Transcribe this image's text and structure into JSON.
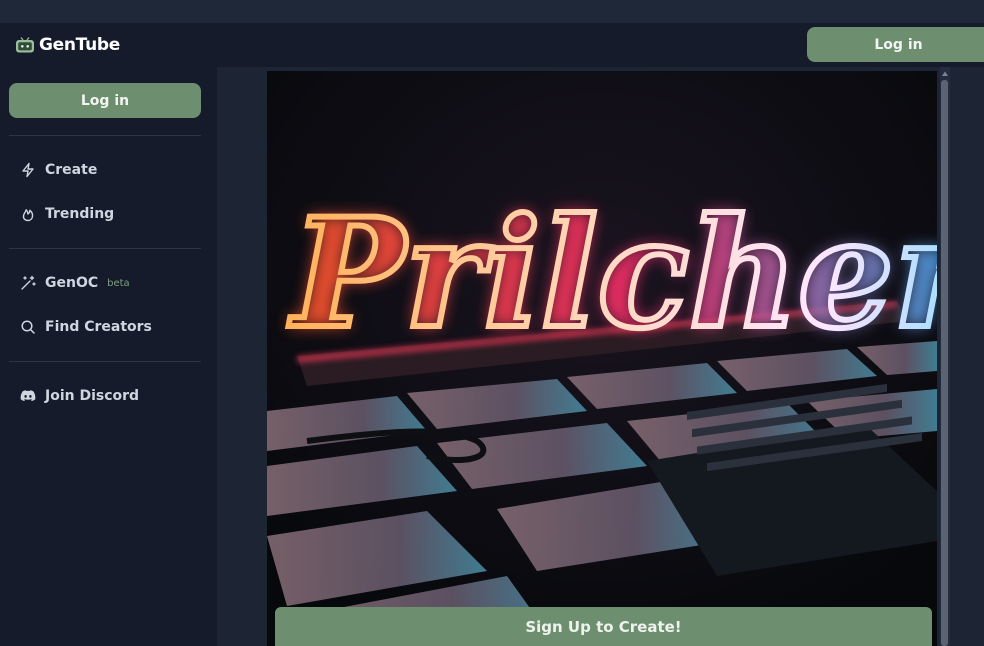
{
  "header": {
    "brand": "GenTube",
    "login_label": "Log in"
  },
  "sidebar": {
    "login_label": "Log in",
    "items": [
      {
        "label": "Create",
        "icon": "lightning-icon"
      },
      {
        "label": "Trending",
        "icon": "flame-icon"
      },
      {
        "label": "GenOC",
        "icon": "magic-wand-icon",
        "badge": "beta"
      },
      {
        "label": "Find Creators",
        "icon": "search-icon"
      },
      {
        "label": "Join Discord",
        "icon": "discord-icon"
      }
    ]
  },
  "main": {
    "image_text": "Prilchen",
    "cta_label": "Sign Up to Create!"
  },
  "colors": {
    "accent_green": "#6d8f6f",
    "background": "#151b2a",
    "content_bg": "#1d2535",
    "beta_badge": "#7aa07d"
  }
}
